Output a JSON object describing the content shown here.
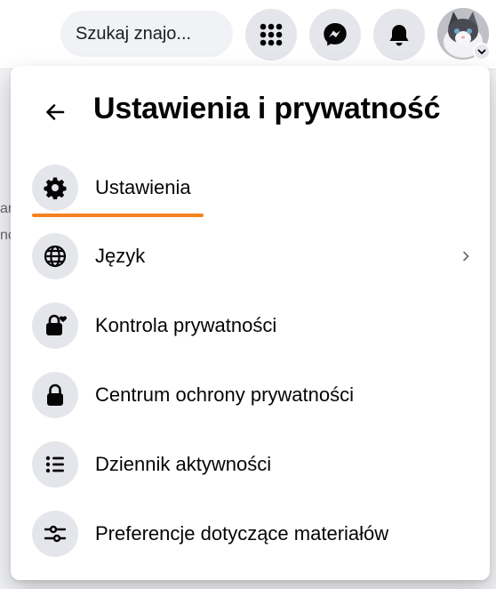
{
  "colors": {
    "underline": "#f5821f",
    "icon_bg": "#e4e6eb",
    "text": "#050505"
  },
  "topbar": {
    "search_text": "Szukaj znajo...",
    "icons": [
      "menu-grid-icon",
      "messenger-icon",
      "notifications-bell-icon",
      "avatar-chevron-down-icon"
    ]
  },
  "background": {
    "cut_text_1": "ar",
    "cut_text_2": "nc"
  },
  "panel": {
    "title": "Ustawienia i prywatność",
    "back_icon": "arrow-left-icon",
    "items": [
      {
        "label": "Ustawienia",
        "icon": "gear-icon"
      },
      {
        "label": "Język",
        "icon": "globe-icon",
        "chevron": "›"
      },
      {
        "label": "Kontrola prywatności",
        "icon": "lock-heart-icon"
      },
      {
        "label": "Centrum ochrony prywatności",
        "icon": "lock-icon"
      },
      {
        "label": "Dziennik aktywności",
        "icon": "list-icon"
      },
      {
        "label": "Preferencje dotyczące materiałów",
        "icon": "sliders-icon"
      }
    ]
  }
}
